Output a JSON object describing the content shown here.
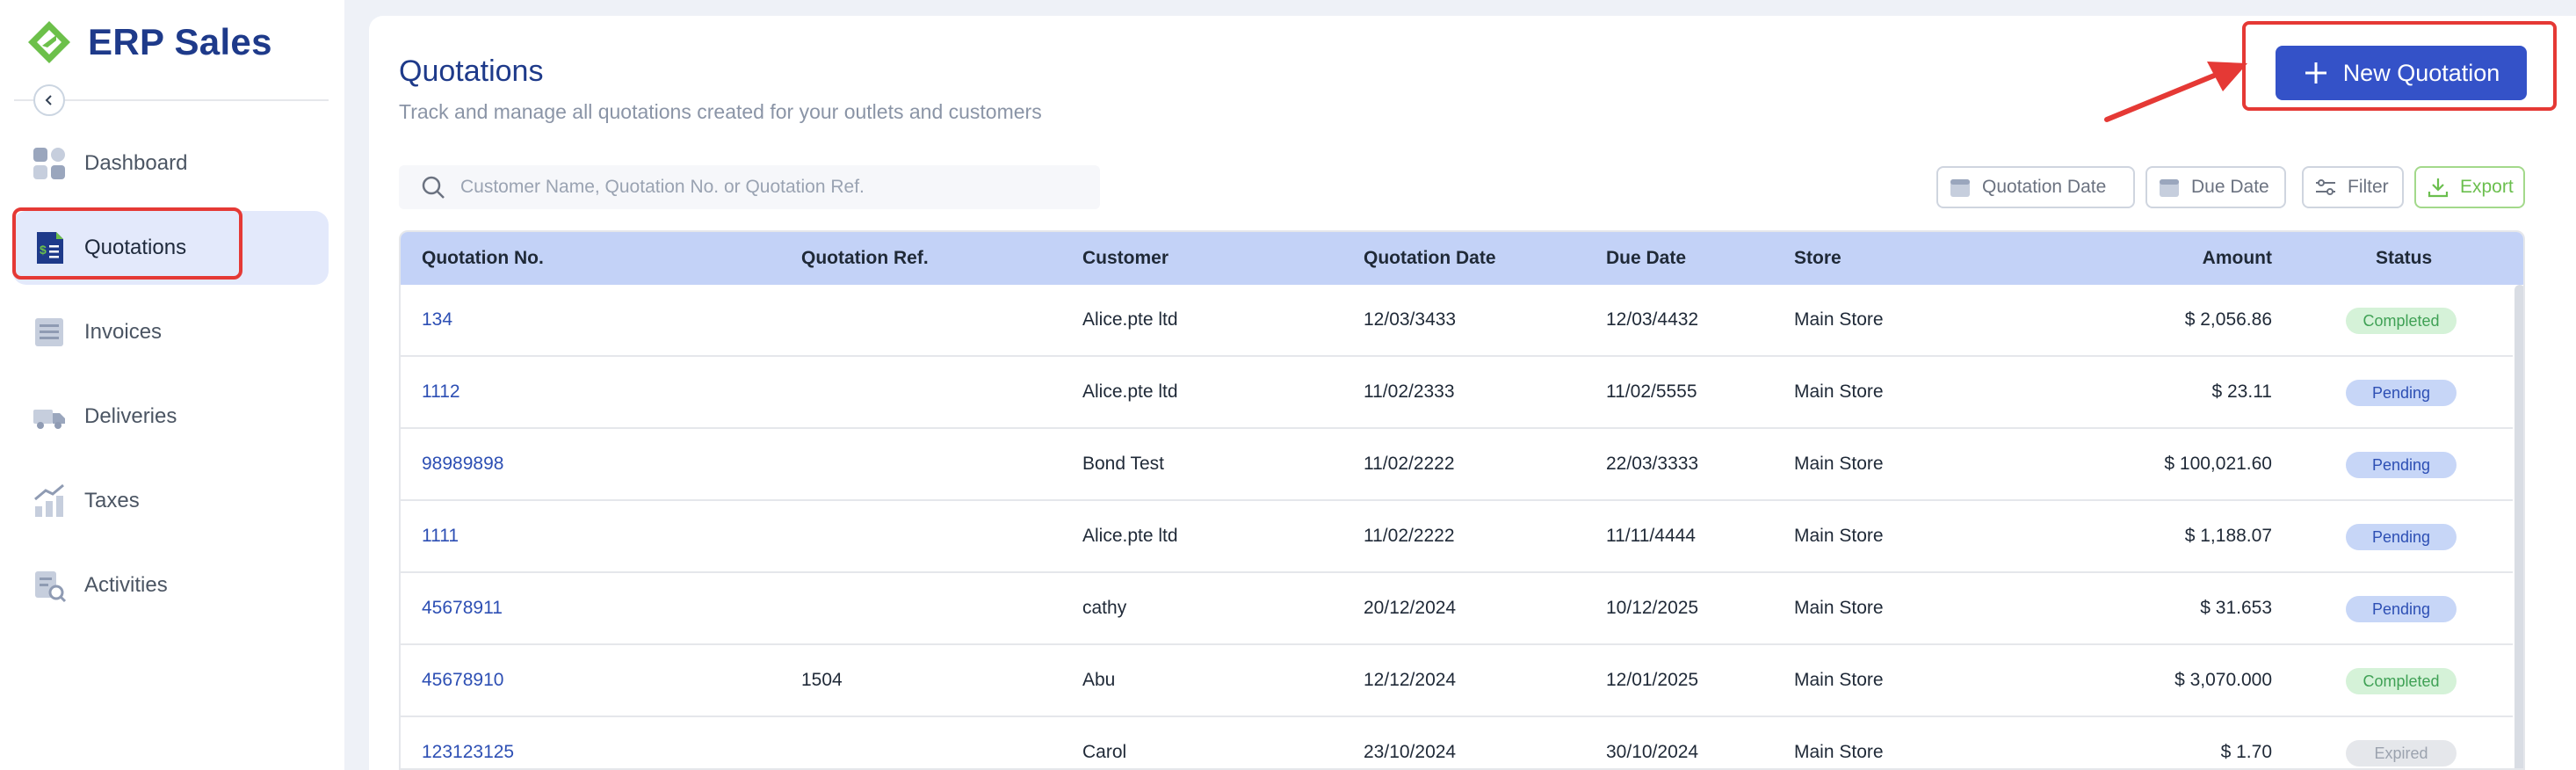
{
  "app": {
    "title": "ERP Sales"
  },
  "sidebar": {
    "items": [
      {
        "label": "Dashboard",
        "icon": "dashboard-icon"
      },
      {
        "label": "Quotations",
        "icon": "quotation-doc-icon",
        "active": true
      },
      {
        "label": "Invoices",
        "icon": "invoice-icon"
      },
      {
        "label": "Deliveries",
        "icon": "truck-icon"
      },
      {
        "label": "Taxes",
        "icon": "tax-icon"
      },
      {
        "label": "Activities",
        "icon": "activity-search-icon"
      }
    ]
  },
  "header": {
    "title": "Quotations",
    "subtitle": "Track and manage all quotations created for your outlets and customers",
    "new_button_label": "New Quotation"
  },
  "search": {
    "placeholder": "Customer Name, Quotation No. or Quotation Ref."
  },
  "filters": {
    "quotation_date": "Quotation Date",
    "due_date": "Due Date",
    "filter": "Filter",
    "export": "Export"
  },
  "table": {
    "columns": [
      "Quotation No.",
      "Quotation Ref.",
      "Customer",
      "Quotation Date",
      "Due Date",
      "Store",
      "Amount",
      "Status"
    ],
    "rows": [
      {
        "no": "134",
        "ref": "",
        "customer": "Alice.pte ltd",
        "qdate": "12/03/3433",
        "due": "12/03/4432",
        "store": "Main Store",
        "amount": "$ 2,056.86",
        "status": "Completed"
      },
      {
        "no": "1112",
        "ref": "",
        "customer": "Alice.pte ltd",
        "qdate": "11/02/2333",
        "due": "11/02/5555",
        "store": "Main Store",
        "amount": "$ 23.11",
        "status": "Pending"
      },
      {
        "no": "98989898",
        "ref": "",
        "customer": "Bond Test",
        "qdate": "11/02/2222",
        "due": "22/03/3333",
        "store": "Main Store",
        "amount": "$ 100,021.60",
        "status": "Pending"
      },
      {
        "no": "1111",
        "ref": "",
        "customer": "Alice.pte ltd",
        "qdate": "11/02/2222",
        "due": "11/11/4444",
        "store": "Main Store",
        "amount": "$ 1,188.07",
        "status": "Pending"
      },
      {
        "no": "45678911",
        "ref": "",
        "customer": "cathy",
        "qdate": "20/12/2024",
        "due": "10/12/2025",
        "store": "Main Store",
        "amount": "$ 31.653",
        "status": "Pending"
      },
      {
        "no": "45678910",
        "ref": "1504",
        "customer": "Abu",
        "qdate": "12/12/2024",
        "due": "12/01/2025",
        "store": "Main Store",
        "amount": "$ 3,070.000",
        "status": "Completed"
      },
      {
        "no": "123123125",
        "ref": "",
        "customer": "Carol",
        "qdate": "23/10/2024",
        "due": "30/10/2024",
        "store": "Main Store",
        "amount": "$ 1.70",
        "status": "Expired"
      }
    ]
  },
  "colors": {
    "brand": "#1e3a8a",
    "accent": "#3452c8",
    "annotation": "#e53935",
    "header_row": "#c3d2f7",
    "logo_green": "#6cc04a"
  }
}
